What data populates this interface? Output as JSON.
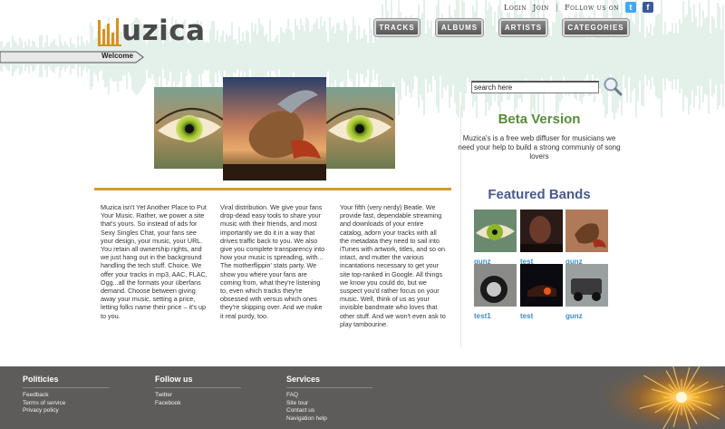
{
  "brand": {
    "name": "uzica",
    "welcome": "Welcome"
  },
  "toplinks": {
    "login": "Login",
    "join": "Join",
    "follow": "Follow us on"
  },
  "nav": [
    "TRACKS",
    "ALBUMS",
    "ARTISTS",
    "CATEGORIES"
  ],
  "search": {
    "value": "search here"
  },
  "beta": {
    "title": "Beta Version",
    "description": "Muzica's is a free web diffuser for musicians we need your help to build a strong communiy of song lovers"
  },
  "columns": [
    "Muzica isn't Yet Another Place to Put Your Music. Rather, we power a site that's yours. So instead of ads for Sexy Singles Chat, your fans see your design, your music, your URL. You retain all ownership rights, and we just hang out in the background handling the tech stuff. Choice. We offer your tracks in mp3, AAC, FLAC, Ogg...all the formats your überfans demand. Choose between giving away your music, setting a price, letting folks name their price – it's up to you.",
    "Viral distribution. We give your fans drop-dead easy tools to share your music with their friends, and most importantly we do it in a way that drives traffic back to you. We also give you complete transparency into how your music is spreading, with... The motherflippin' stats party. We show you where your fans are coming from, what they're listening to, even which tracks they're obsessed with versus which ones they're skipping over. And we make it real purdy, too.",
    "Your fifth (very nerdy) Beatle. We provide fast, dependable streaming and downloads of your entire catalog, adorn your tracks with all the metadata they need to sail into iTunes with artwork, titles, and so on intact, and mutter the various incantations necessary to get your site top-ranked in Google. All things we know you could do, but we suspect you'd rather focus on your music. Well, think of us as your invisible bandmate who loves that other stuff. And we won't even ask to play tambourine."
  ],
  "featured": {
    "title": "Featured Bands",
    "bands": [
      {
        "name": "gunz",
        "icon": "eye-thumbnail"
      },
      {
        "name": "test",
        "icon": "dark-face-thumbnail"
      },
      {
        "name": "gunz",
        "icon": "bird-thumbnail"
      },
      {
        "name": "test1",
        "icon": "car-wheel-thumbnail"
      },
      {
        "name": "test",
        "icon": "night-car-thumbnail"
      },
      {
        "name": "gunz",
        "icon": "car-thumbnail"
      }
    ]
  },
  "footer": {
    "policies": {
      "title": "Politicies",
      "links": [
        "Feedback",
        "Terms of service",
        "Privacy policy"
      ]
    },
    "follow": {
      "title": "Follow us",
      "links": [
        "Twitter",
        "Facebook"
      ]
    },
    "services": {
      "title": "Services",
      "links": [
        "FAQ",
        "Site tour",
        "Contact us",
        "Navigation help"
      ]
    }
  },
  "colors": {
    "accent_orange": "#d29a2e",
    "beta_green": "#5a8c3c",
    "featured_blue": "#4a5a8c",
    "band_link": "#3a8fc7",
    "footer_bg": "#5e5c5a"
  }
}
